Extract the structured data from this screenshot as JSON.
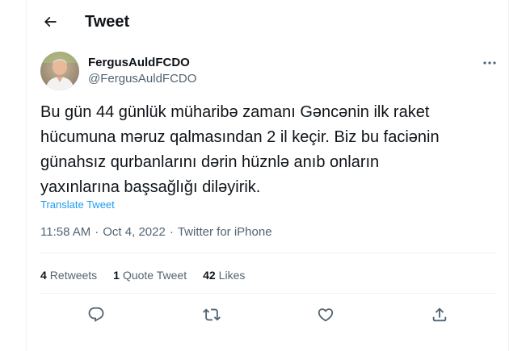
{
  "header": {
    "title": "Tweet"
  },
  "tweet": {
    "display_name": "FergusAuldFCDO",
    "handle": "@FergusAuldFCDO",
    "text": "Bu gün 44 günlük müharibə zamanı Gəncənin ilk raket\nhücumuna məruz qalmasından 2 il keçir. Biz bu faciənin\ngünahsız qurbanlarını dərin hüznlə anıb onların\nyaxınlarına başsağlığı diləyirik.",
    "translate_label": "Translate Tweet",
    "time": "11:58 AM",
    "date": "Oct 4, 2022",
    "separator": "·",
    "source": "Twitter for iPhone"
  },
  "stats": {
    "retweets_count": "4",
    "retweets_label": "Retweets",
    "quotes_count": "1",
    "quotes_label": "Quote Tweet",
    "likes_count": "42",
    "likes_label": "Likes"
  },
  "actions": {
    "icons": [
      "reply-icon",
      "retweet-icon",
      "like-icon",
      "share-icon"
    ]
  },
  "colors": {
    "text": "#0f1419",
    "secondary": "#536471",
    "accent": "#1d9bf0",
    "border": "#eff3f4"
  }
}
